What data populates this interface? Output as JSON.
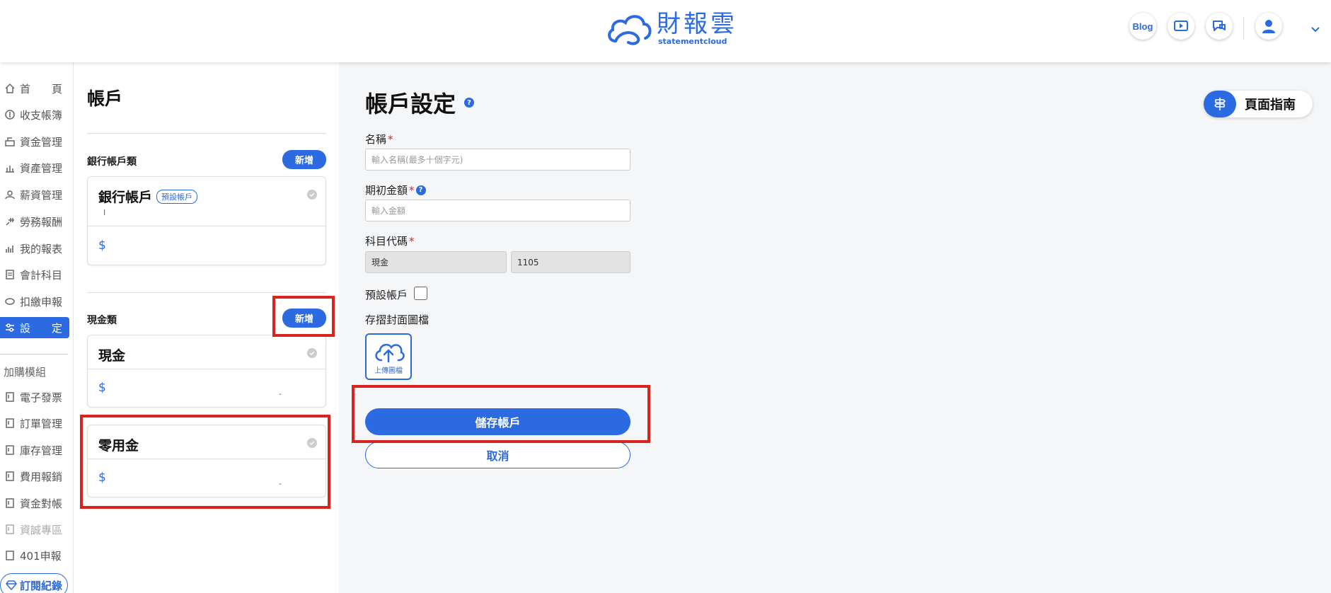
{
  "header": {
    "logo_cn": "財報雲",
    "logo_en": "statementcloud",
    "blog_label": "Blog"
  },
  "sidebar": {
    "items": [
      {
        "label": "首　　頁",
        "icon": "home-icon"
      },
      {
        "label": "收支帳簿",
        "icon": "coin-icon"
      },
      {
        "label": "資金管理",
        "icon": "fund-icon"
      },
      {
        "label": "資產管理",
        "icon": "asset-icon"
      },
      {
        "label": "薪資管理",
        "icon": "salary-icon"
      },
      {
        "label": "勞務報酬",
        "icon": "service-icon"
      },
      {
        "label": "我的報表",
        "icon": "chart-icon"
      },
      {
        "label": "會計科目",
        "icon": "ledger-icon"
      },
      {
        "label": "扣繳申報",
        "icon": "tax-icon"
      },
      {
        "label": "設　　定",
        "icon": "settings-icon"
      }
    ],
    "addon_title": "加購模組",
    "addons": [
      {
        "label": "電子發票"
      },
      {
        "label": "訂單管理"
      },
      {
        "label": "庫存管理"
      },
      {
        "label": "費用報銷"
      },
      {
        "label": "資金對帳"
      },
      {
        "label": "資誠專區"
      },
      {
        "label": "401申報"
      }
    ],
    "subscription_label": "訂閱紀錄"
  },
  "accounts": {
    "title": "帳戶",
    "add_label": "新增",
    "bank_group": {
      "label": "銀行帳戶類",
      "card": {
        "name": "銀行帳戶",
        "badge": "預設帳戶",
        "sub": "I",
        "currency": "$"
      }
    },
    "cash_group": {
      "label": "現金類",
      "cards": [
        {
          "name": "現金",
          "currency": "$",
          "mark": "-"
        },
        {
          "name": "零用金",
          "currency": "$",
          "mark": "-"
        }
      ]
    }
  },
  "form": {
    "title": "帳戶設定",
    "guide_label": "頁面指南",
    "name_label": "名稱",
    "name_placeholder": "輸入名稱(最多十個字元)",
    "opening_label": "期初金額",
    "opening_placeholder": "輸入金額",
    "code_label": "科目代碼",
    "code_name": "現金",
    "code_value": "1105",
    "default_label": "預設帳戶",
    "default_checked": false,
    "cover_label": "存摺封面圖檔",
    "upload_label": "上傳圖檔",
    "save_label": "儲存帳戶",
    "cancel_label": "取消",
    "required_mark": "*"
  },
  "colors": {
    "accent": "#2b6ae0",
    "highlight": "#d9231f"
  }
}
